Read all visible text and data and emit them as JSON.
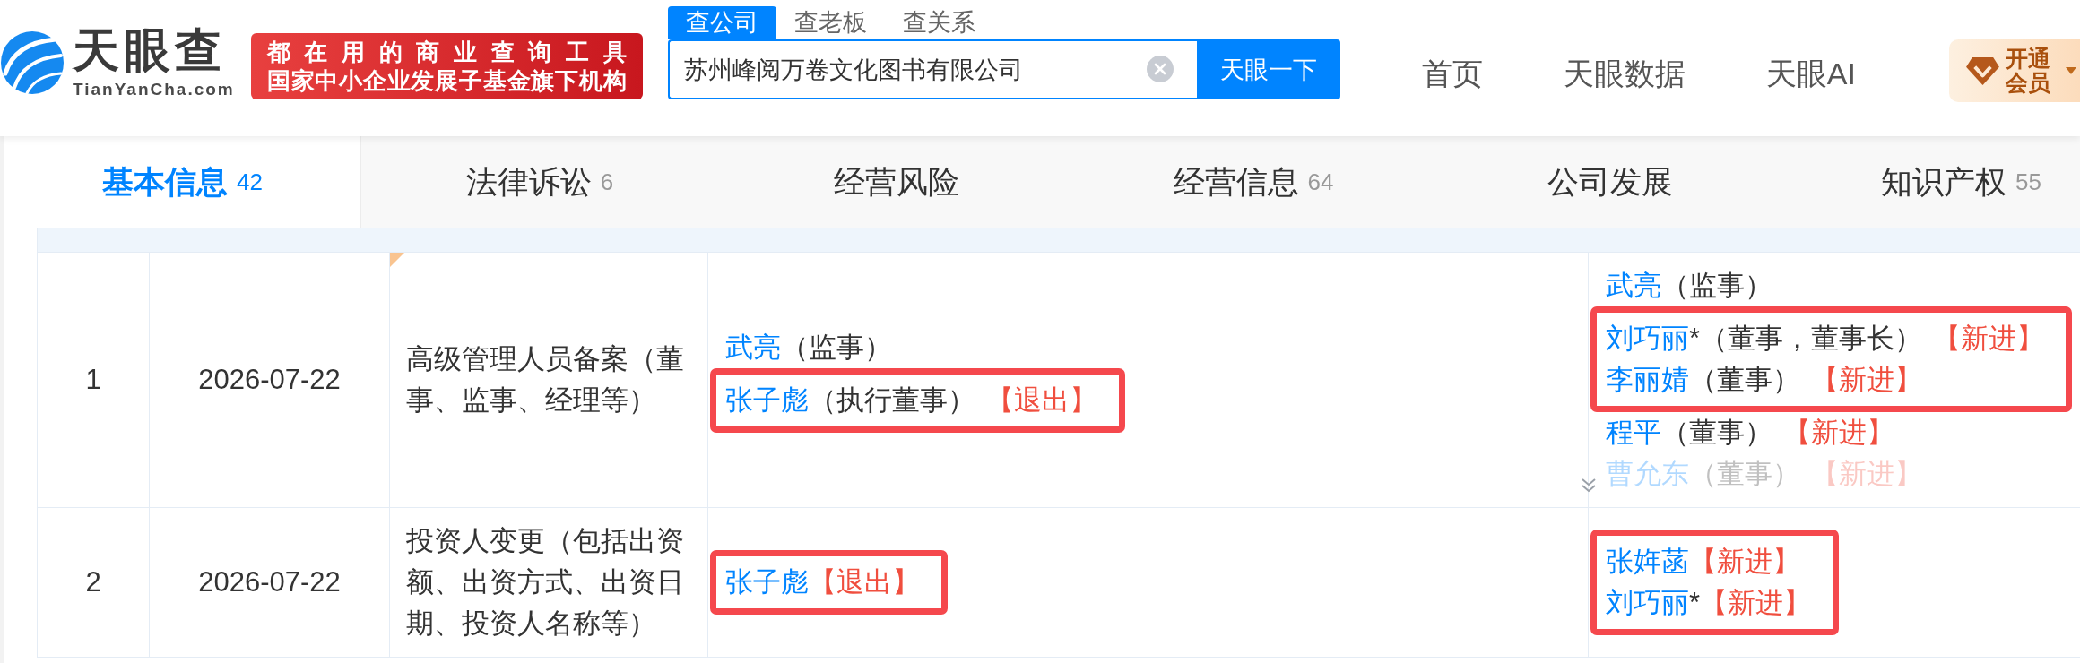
{
  "header": {
    "logo": {
      "name": "天眼查",
      "domain": "TianYanCha.com"
    },
    "banner": {
      "lines": [
        "都在用的商业查询工具",
        "国家中小企业发展子基金旗下机构"
      ]
    },
    "search": {
      "tabs": [
        {
          "label": "查公司",
          "selected": true
        },
        {
          "label": "查老板",
          "selected": false
        },
        {
          "label": "查关系",
          "selected": false
        }
      ],
      "value": "苏州峰阅万卷文化图书有限公司",
      "button": "天眼一下"
    },
    "nav": [
      "首页",
      "天眼数据",
      "天眼AI"
    ],
    "member_button": "开通会员"
  },
  "tabs": [
    {
      "label": "基本信息",
      "count": "42",
      "selected": true
    },
    {
      "label": "法律诉讼",
      "count": "6",
      "selected": false
    },
    {
      "label": "经营风险",
      "selected": false
    },
    {
      "label": "经营信息",
      "count": "64",
      "selected": false
    },
    {
      "label": "公司发展",
      "selected": false
    },
    {
      "label": "知识产权",
      "count": "55",
      "selected": false
    }
  ],
  "table": {
    "rows": [
      {
        "index": "1",
        "date": "2026-07-22",
        "item": "高级管理人员备案（董事、监事、经理等）",
        "marked": true,
        "before": {
          "collapsed": false,
          "entries": [
            {
              "name": "武亮",
              "role": "（监事）",
              "highlighted": false
            },
            {
              "name": "张子彪",
              "role": "（执行董事）",
              "tag": "【退出】",
              "highlighted": true
            }
          ]
        },
        "after": {
          "collapsed": true,
          "entries": [
            {
              "name": "武亮",
              "role": "（监事）",
              "highlighted": false
            },
            {
              "name": "刘巧丽",
              "suffix": "*",
              "role": "（董事，董事长）",
              "tag": "【新进】",
              "highlighted": true
            },
            {
              "name": "李丽婧",
              "role": "（董事）",
              "tag": "【新进】",
              "highlighted": true
            },
            {
              "name": "程平",
              "role": "（董事）",
              "tag": "【新进】",
              "highlighted": false
            },
            {
              "name": "曹允东",
              "role": "（董事）",
              "tag": "【新进】",
              "highlighted": false
            }
          ]
        }
      },
      {
        "index": "2",
        "date": "2026-07-22",
        "item": "投资人变更（包括出资额、出资方式、出资日期、投资人名称等）",
        "marked": false,
        "before": {
          "collapsed": false,
          "entries": [
            {
              "name": "张子彪",
              "tag": "【退出】",
              "highlighted": true
            }
          ]
        },
        "after": {
          "collapsed": false,
          "entries": [
            {
              "name": "张姩菡",
              "tag": "【新进】",
              "highlighted": true
            },
            {
              "name": "刘巧丽",
              "suffix": "*",
              "tag": "【新进】",
              "highlighted": true
            }
          ]
        }
      }
    ]
  }
}
